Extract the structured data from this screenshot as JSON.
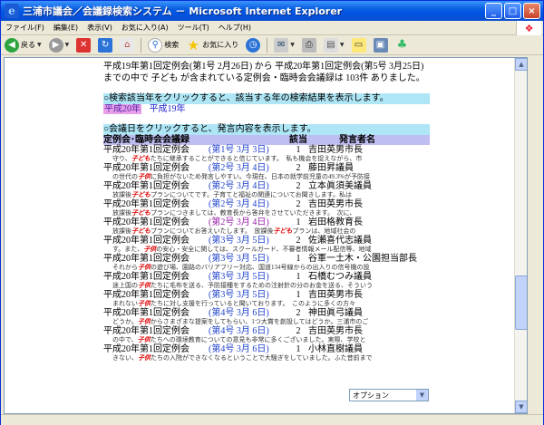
{
  "window": {
    "title": "三浦市議会／会議録検索システム － Microsoft Internet Explorer"
  },
  "menu": [
    "ファイル(F)",
    "編集(E)",
    "表示(V)",
    "お気に入り(A)",
    "ツール(T)",
    "ヘルプ(H)"
  ],
  "toolbar": {
    "back": "戻る",
    "search": "検索",
    "favorites": "お気に入り"
  },
  "intro": "平成19年第1回定例会(第1号 2月26日) から 平成20年第1回定例会(第5号 3月25日)までの中で 子ども が含まれている定例会・臨時会会議録は 103件 ありました。",
  "year_prompt": "○検索該当年をクリックすると、該当する年の検索結果を表示します。",
  "years": [
    "平成20年",
    "平成19年"
  ],
  "date_prompt": "○会議日をクリックすると、発言内容を表示します。",
  "table_header": {
    "meeting": "定例会･臨時会会議録",
    "num": "該当",
    "speaker": "発言者名"
  },
  "records": [
    {
      "meeting": "平成20年第1回定例会",
      "date": "(第1号 3月 3日)",
      "num": "1",
      "speaker": "吉田英男市長",
      "pre": "守り、",
      "kw": "子ども",
      "post": "たちに継承することができると信じています。　私も機会を捉えながら、市"
    },
    {
      "meeting": "平成20年第1回定例会",
      "date": "(第2号 3月 4日)",
      "num": "2",
      "speaker": "藤田昇議員",
      "pre": "の世代の",
      "kw": "子供",
      "post": "に負担がないため発言しやすい。今現在、日本の就学前児童の49.3%が予防接"
    },
    {
      "meeting": "平成20年第1回定例会",
      "date": "(第2号 3月 4日)",
      "num": "2",
      "speaker": "立本眞須美議員",
      "pre": "放課後",
      "kw": "子ども",
      "post": "プランについてです。子育てと福祉の関連についてお聞きします。私は"
    },
    {
      "meeting": "平成20年第1回定例会",
      "date": "(第2号 3月 4日)",
      "num": "2",
      "speaker": "吉田英男市長",
      "pre": "放課後",
      "kw": "子ども",
      "post": "プランにつきましては、教育長から答弁をさせていただきます。　次に、"
    },
    {
      "meeting": "平成20年第1回定例会",
      "date": "(第2号 3月 4日)",
      "num": "1",
      "speaker": "岩田格教育長",
      "pre": "放課後",
      "kw": "子ども",
      "post": "プランについてお答えいたします。　放課後",
      "kw2": "子ども",
      "post2": "プランは、地域社会の"
    },
    {
      "meeting": "平成20年第1回定例会",
      "date": "(第3号 3月 5日)",
      "num": "2",
      "speaker": "佐瀬喜代志議員",
      "pre": "す。また、",
      "kw": "子供",
      "post": "の安心・安全に関しては、スクールガード、不審者情報メール配信等、地域"
    },
    {
      "meeting": "平成20年第1回定例会",
      "date": "(第3号 3月 5日)",
      "num": "1",
      "speaker": "谷軍一土木・公園担当部長",
      "pre": "それから",
      "kw": "子供",
      "post": "の遊び場、園路のバリアフリー対応、国道134号線からの出入りの信号機の設"
    },
    {
      "meeting": "平成20年第1回定例会",
      "date": "(第3号 3月 5日)",
      "num": "1",
      "speaker": "石橋むつみ議員",
      "pre": "途上国の",
      "kw": "子供",
      "post": "たちに毛布を送る、予防接種をするための注射針の分のお金を送る、そういう"
    },
    {
      "meeting": "平成20年第1回定例会",
      "date": "(第3号 3月 5日)",
      "num": "1",
      "speaker": "吉田英男市長",
      "pre": "まれない",
      "kw": "子供",
      "post": "たちに対し支援を行っていると聞いております。　このように多くの方々"
    },
    {
      "meeting": "平成20年第1回定例会",
      "date": "(第4号 3月 6日)",
      "num": "2",
      "speaker": "神田眞弓議員",
      "pre": "どうか。",
      "kw": "子供",
      "post": "からさまざまな提案をしてもらい、1つ大賞を創設してはどうか。三浦市のご"
    },
    {
      "meeting": "平成20年第1回定例会",
      "date": "(第4号 3月 6日)",
      "num": "2",
      "speaker": "吉田英男市長",
      "pre": "の中で、",
      "kw": "子供",
      "post": "たちへの環境教育についての意見も非常に多くございました。実際、学校と"
    },
    {
      "meeting": "平成20年第1回定例会",
      "date": "(第4号 3月 6日)",
      "num": "1",
      "speaker": "小林直樹議員",
      "pre": "きない、",
      "kw": "子供",
      "post": "たちの入院ができなくなるということで大騒ぎをしていました。ふた昔前まで"
    }
  ],
  "option_select": {
    "value": "オプション"
  }
}
